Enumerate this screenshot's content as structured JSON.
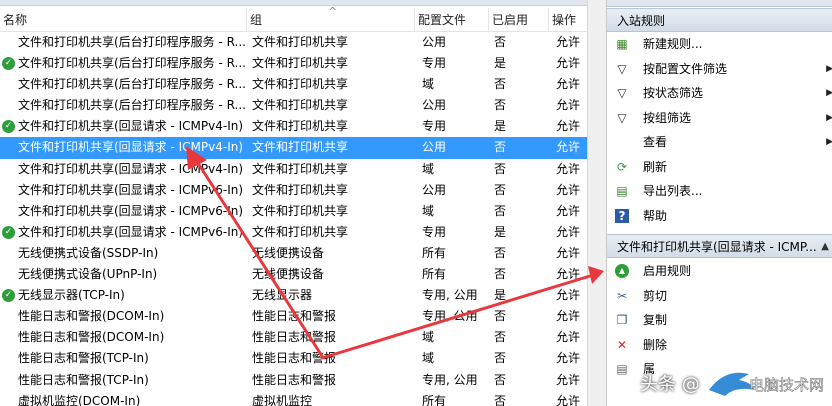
{
  "table": {
    "columns": {
      "name": "名称",
      "group": "组",
      "profile": "配置文件",
      "enabled": "已启用",
      "action": "操作"
    },
    "rows": [
      {
        "name": "文件和打印机共享(后台打印程序服务 - R...",
        "group": "文件和打印机共享",
        "profile": "公用",
        "enabled": "否",
        "action": "允许",
        "checked": false,
        "selected": false
      },
      {
        "name": "文件和打印机共享(后台打印程序服务 - R...",
        "group": "文件和打印机共享",
        "profile": "专用",
        "enabled": "是",
        "action": "允许",
        "checked": true,
        "selected": false
      },
      {
        "name": "文件和打印机共享(后台打印程序服务 - R...",
        "group": "文件和打印机共享",
        "profile": "域",
        "enabled": "否",
        "action": "允许",
        "checked": false,
        "selected": false
      },
      {
        "name": "文件和打印机共享(后台打印程序服务 - R...",
        "group": "文件和打印机共享",
        "profile": "公用",
        "enabled": "否",
        "action": "允许",
        "checked": false,
        "selected": false
      },
      {
        "name": "文件和打印机共享(回显请求 - ICMPv4-In)",
        "group": "文件和打印机共享",
        "profile": "专用",
        "enabled": "是",
        "action": "允许",
        "checked": true,
        "selected": false
      },
      {
        "name": "文件和打印机共享(回显请求 - ICMPv4-In)",
        "group": "文件和打印机共享",
        "profile": "公用",
        "enabled": "否",
        "action": "允许",
        "checked": false,
        "selected": true
      },
      {
        "name": "文件和打印机共享(回显请求 - ICMPv4-In)",
        "group": "文件和打印机共享",
        "profile": "域",
        "enabled": "否",
        "action": "允许",
        "checked": false,
        "selected": false
      },
      {
        "name": "文件和打印机共享(回显请求 - ICMPv6-In)",
        "group": "文件和打印机共享",
        "profile": "公用",
        "enabled": "否",
        "action": "允许",
        "checked": false,
        "selected": false
      },
      {
        "name": "文件和打印机共享(回显请求 - ICMPv6-In)",
        "group": "文件和打印机共享",
        "profile": "域",
        "enabled": "否",
        "action": "允许",
        "checked": false,
        "selected": false
      },
      {
        "name": "文件和打印机共享(回显请求 - ICMPv6-In)",
        "group": "文件和打印机共享",
        "profile": "专用",
        "enabled": "是",
        "action": "允许",
        "checked": true,
        "selected": false
      },
      {
        "name": "无线便携式设备(SSDP-In)",
        "group": "无线便携设备",
        "profile": "所有",
        "enabled": "否",
        "action": "允许",
        "checked": false,
        "selected": false
      },
      {
        "name": "无线便携式设备(UPnP-In)",
        "group": "无线便携设备",
        "profile": "所有",
        "enabled": "否",
        "action": "允许",
        "checked": false,
        "selected": false
      },
      {
        "name": "无线显示器(TCP-In)",
        "group": "无线显示器",
        "profile": "专用, 公用",
        "enabled": "是",
        "action": "允许",
        "checked": true,
        "selected": false
      },
      {
        "name": "性能日志和警报(DCOM-In)",
        "group": "性能日志和警报",
        "profile": "专用, 公用",
        "enabled": "否",
        "action": "允许",
        "checked": false,
        "selected": false
      },
      {
        "name": "性能日志和警报(DCOM-In)",
        "group": "性能日志和警报",
        "profile": "域",
        "enabled": "否",
        "action": "允许",
        "checked": false,
        "selected": false
      },
      {
        "name": "性能日志和警报(TCP-In)",
        "group": "性能日志和警报",
        "profile": "域",
        "enabled": "否",
        "action": "允许",
        "checked": false,
        "selected": false
      },
      {
        "name": "性能日志和警报(TCP-In)",
        "group": "性能日志和警报",
        "profile": "专用, 公用",
        "enabled": "否",
        "action": "允许",
        "checked": false,
        "selected": false
      },
      {
        "name": "虚拟机监控(DCOM-In)",
        "group": "虚拟机监控",
        "profile": "所有",
        "enabled": "否",
        "action": "允许",
        "checked": false,
        "selected": false
      }
    ]
  },
  "actions": {
    "section1_title": "入站规则",
    "section1_items": [
      {
        "label": "新建规则...",
        "icon": "new-rule-icon",
        "submenu": false
      },
      {
        "label": "按配置文件筛选",
        "icon": "filter-icon",
        "submenu": true
      },
      {
        "label": "按状态筛选",
        "icon": "filter-icon",
        "submenu": true
      },
      {
        "label": "按组筛选",
        "icon": "filter-icon",
        "submenu": true
      },
      {
        "label": "查看",
        "icon": "view-icon",
        "submenu": true
      },
      {
        "label": "刷新",
        "icon": "refresh-icon",
        "submenu": false
      },
      {
        "label": "导出列表...",
        "icon": "export-icon",
        "submenu": false
      },
      {
        "label": "帮助",
        "icon": "help-icon",
        "submenu": false
      }
    ],
    "section2_title": "文件和打印机共享(回显请求 - ICMP...",
    "section2_items": [
      {
        "label": "启用规则",
        "icon": "enable-rule-icon"
      },
      {
        "label": "剪切",
        "icon": "cut-icon"
      },
      {
        "label": "复制",
        "icon": "copy-icon"
      },
      {
        "label": "删除",
        "icon": "delete-icon"
      },
      {
        "label": "属",
        "icon": "properties-icon"
      }
    ]
  },
  "watermark": {
    "text": "头条 @",
    "logo_text": "电脑技术网"
  },
  "colors": {
    "selected_row": "#3399ff",
    "enabled_check": "#2e9e3a",
    "annotation_arrow": "#e8383d"
  }
}
